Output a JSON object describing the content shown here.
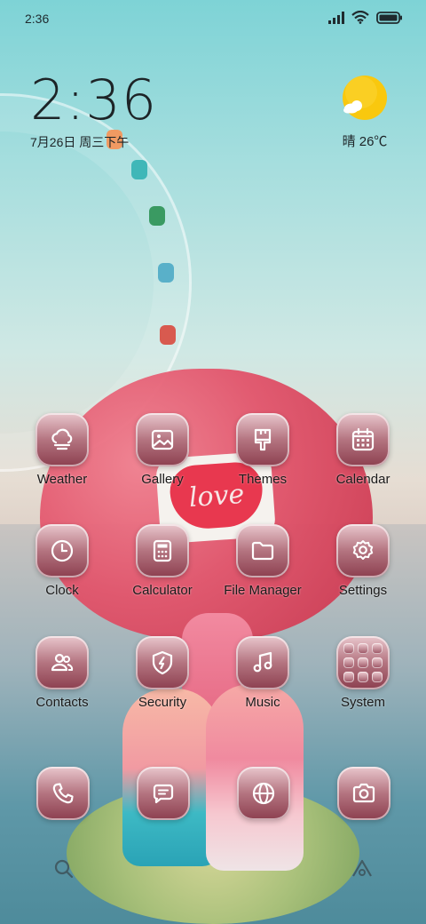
{
  "status_bar": {
    "time": "2:36",
    "icons": [
      "signal-icon",
      "wifi-icon",
      "battery-icon"
    ]
  },
  "clock_widget": {
    "time": "2:36",
    "date": "7月26日 周三下午"
  },
  "weather_widget": {
    "icon": "sun-cloud-icon",
    "text": "晴 26℃"
  },
  "apps": [
    {
      "label": "Weather",
      "icon": "cloud-icon"
    },
    {
      "label": "Gallery",
      "icon": "image-icon"
    },
    {
      "label": "Themes",
      "icon": "brush-icon"
    },
    {
      "label": "Calendar",
      "icon": "calendar-icon"
    },
    {
      "label": "Clock",
      "icon": "clock-icon"
    },
    {
      "label": "Calculator",
      "icon": "calculator-icon"
    },
    {
      "label": "File Manager",
      "icon": "folder-icon"
    },
    {
      "label": "Settings",
      "icon": "gear-icon"
    },
    {
      "label": "Contacts",
      "icon": "people-icon"
    },
    {
      "label": "Security",
      "icon": "shield-icon"
    },
    {
      "label": "Music",
      "icon": "music-note-icon"
    },
    {
      "label": "System",
      "icon": "folder-grid-icon"
    }
  ],
  "dock": [
    {
      "icon": "phone-icon"
    },
    {
      "icon": "message-icon"
    },
    {
      "icon": "browser-icon"
    },
    {
      "icon": "camera-icon"
    }
  ],
  "wallpaper": {
    "heart_text": "love"
  },
  "colors": {
    "icon_gradient_top": "#e9c7cd",
    "icon_gradient_bottom": "#8c3f4f",
    "label_color": "#1a1a1a",
    "sun_color": "#f9c80e"
  }
}
